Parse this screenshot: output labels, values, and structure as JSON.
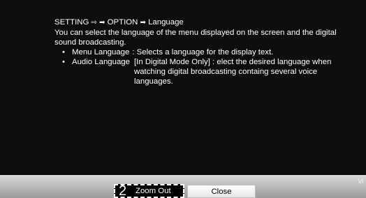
{
  "breadcrumb": {
    "setting": "SETTING",
    "sep1": "⇨",
    "sep2": "➡",
    "option": "OPTION",
    "sep3": "➡",
    "language": "Language"
  },
  "description": "You can select the language of the menu displayed on the screen and the digital sound broadcasting.",
  "bullets": [
    {
      "bullet": "•",
      "term": "Menu Language",
      "text": ": Selects a language for the display text."
    },
    {
      "bullet": "•",
      "term": "Audio Language",
      "text": "[In Digital Mode Only] : elect the desired language when watching digital broadcasting containg several voice languages."
    }
  ],
  "footer": {
    "corner_text": "VI",
    "zoom_number": "2",
    "zoom_label": "Zoom Out",
    "close_label": "Close"
  },
  "colors": {
    "background": "#0d0d0d",
    "text": "#ffffff",
    "footer_top": "#d9d9d9",
    "footer_bottom": "#9a9a9a"
  }
}
